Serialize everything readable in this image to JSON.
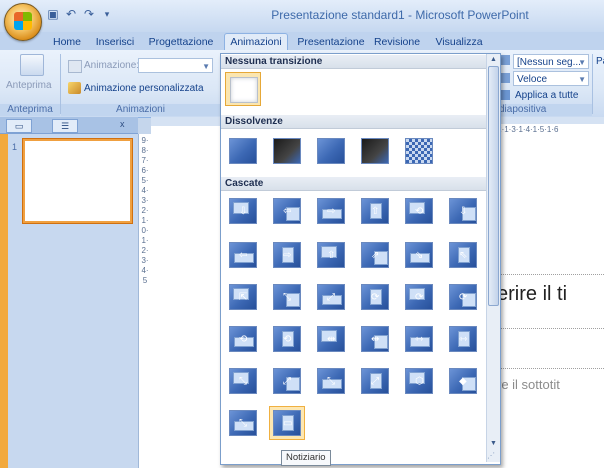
{
  "app": {
    "title": "Presentazione standard1 - Microsoft PowerPoint"
  },
  "quick_access": {
    "icons": [
      "save-icon",
      "undo-icon",
      "redo-icon",
      "customize-icon"
    ]
  },
  "tabs": [
    {
      "label": "Home"
    },
    {
      "label": "Inserisci"
    },
    {
      "label": "Progettazione"
    },
    {
      "label": "Animazioni",
      "active": true
    },
    {
      "label": "Presentazione"
    },
    {
      "label": "Revisione"
    },
    {
      "label": "Visualizza"
    }
  ],
  "ribbon": {
    "preview_group": {
      "button_label": "Anteprima",
      "group_label": "Anteprima"
    },
    "animations_group": {
      "animation_label": "Animazione:",
      "animation_value": "",
      "custom_label": "Animazione personalizzata",
      "group_label": "Animazioni"
    },
    "transition_group": {
      "sound_value": "[Nessun seg...",
      "speed_value": "Veloce",
      "apply_all_label": "Applica a tutte",
      "group_label": "diapositiva",
      "cut_label": "Pa"
    }
  },
  "left_pane": {
    "slide_number": "1"
  },
  "rulers": {
    "vertical": "9·8·7·6·5·4·3·2·1·0·1·2·3·4·5",
    "horizontal": "1·2·1·3·1·4·1·5·1·6"
  },
  "slide": {
    "title_placeholder": "erire il ti",
    "subtitle_placeholder": "re il sottotit"
  },
  "gallery": {
    "sections": [
      {
        "title": "Nessuna transizione"
      },
      {
        "title": "Dissolvenze"
      },
      {
        "title": "Cascate"
      }
    ],
    "tooltip": "Notiziario",
    "accent_hover": "#f0b040",
    "thumbnail_color": "#3c68b4"
  }
}
